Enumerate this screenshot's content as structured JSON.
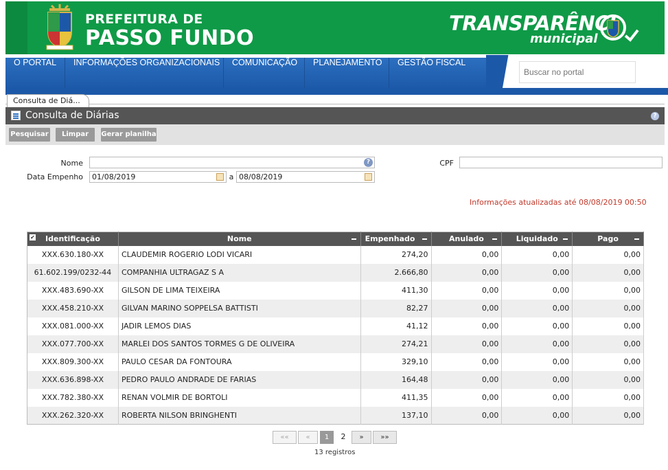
{
  "header": {
    "title_line1": "PREFEITURA DE",
    "title_line2": "PASSO FUNDO",
    "logo_main": "TRANSPARÊNCI",
    "logo_sub": "municipal"
  },
  "nav": {
    "items": [
      "O PORTAL",
      "INFORMAÇÕES ORGANIZACIONAIS",
      "COMUNICAÇÃO",
      "PLANEJAMENTO",
      "GESTÃO FISCAL"
    ],
    "search_placeholder": "Buscar no portal"
  },
  "breadcrumb": "Consulta de Diá...",
  "panel": {
    "title": "Consulta de Diárias",
    "buttons": {
      "search": "Pesquisar",
      "clear": "Limpar",
      "sheet": "Gerar planilha"
    }
  },
  "form": {
    "name_label": "Nome",
    "cpf_label": "CPF",
    "date_label": "Data Empenho",
    "date_from": "01/08/2019",
    "date_sep": "a",
    "date_to": "08/08/2019",
    "info": "Informações atualizadas até 08/08/2019 00:50"
  },
  "table": {
    "headers": [
      "Identificação",
      "Nome",
      "Empenhado",
      "Anulado",
      "Liquidado",
      "Pago"
    ],
    "rows": [
      [
        "XXX.630.180-XX",
        "CLAUDEMIR ROGERIO LODI VICARI",
        "274,20",
        "0,00",
        "0,00",
        "0,00"
      ],
      [
        "61.602.199/0232-44",
        "COMPANHIA ULTRAGAZ S A",
        "2.666,80",
        "0,00",
        "0,00",
        "0,00"
      ],
      [
        "XXX.483.690-XX",
        "GILSON DE LIMA TEIXEIRA",
        "411,30",
        "0,00",
        "0,00",
        "0,00"
      ],
      [
        "XXX.458.210-XX",
        "GILVAN MARINO SOPPELSA BATTISTI",
        "82,27",
        "0,00",
        "0,00",
        "0,00"
      ],
      [
        "XXX.081.000-XX",
        "JADIR LEMOS DIAS",
        "41,12",
        "0,00",
        "0,00",
        "0,00"
      ],
      [
        "XXX.077.700-XX",
        "MARLEI DOS SANTOS TORMES G DE OLIVEIRA",
        "274,21",
        "0,00",
        "0,00",
        "0,00"
      ],
      [
        "XXX.809.300-XX",
        "PAULO CESAR DA FONTOURA",
        "329,10",
        "0,00",
        "0,00",
        "0,00"
      ],
      [
        "XXX.636.898-XX",
        "PEDRO PAULO ANDRADE DE FARIAS",
        "164,48",
        "0,00",
        "0,00",
        "0,00"
      ],
      [
        "XXX.782.380-XX",
        "RENAN VOLMIR DE BORTOLI",
        "411,35",
        "0,00",
        "0,00",
        "0,00"
      ],
      [
        "XXX.262.320-XX",
        "ROBERTA NILSON BRINGHENTI",
        "137,10",
        "0,00",
        "0,00",
        "0,00"
      ]
    ]
  },
  "pager": {
    "first": "««",
    "prev": "«",
    "pages": [
      "1",
      "2"
    ],
    "next": "»",
    "last": "»»",
    "records": "13 registros"
  },
  "colors": {
    "brand_green": "#0f9a47",
    "nav_blue": "#2c6fc0",
    "panel_gray": "#555555",
    "info_red": "#c0392b"
  }
}
